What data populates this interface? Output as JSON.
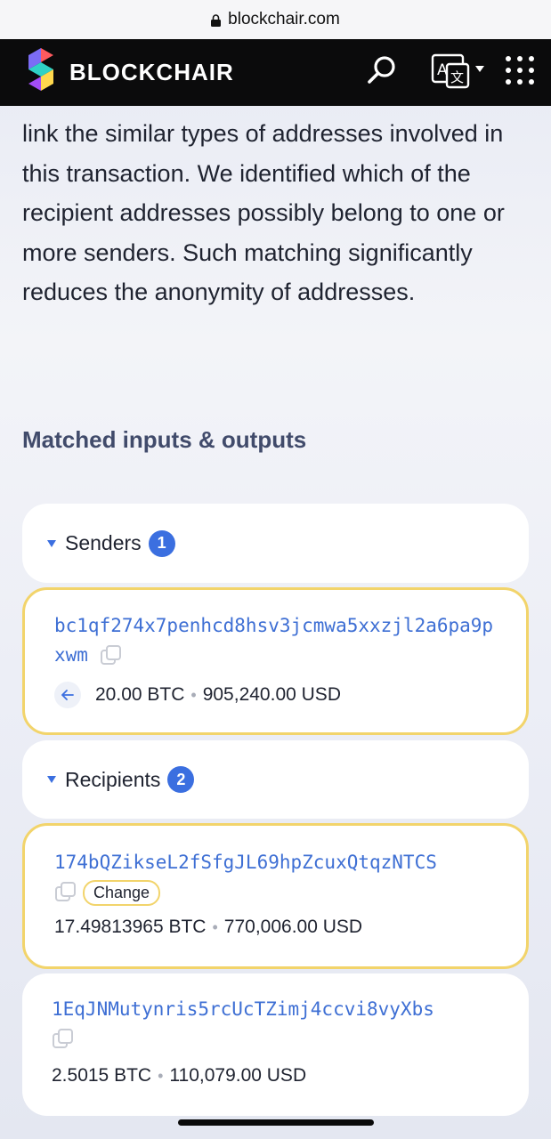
{
  "browser": {
    "url": "blockchair.com"
  },
  "header": {
    "brand": "BLOCKCHAIR"
  },
  "intro": {
    "text": "link the similar types of addresses involved in this transaction. We identified which of the recipient addresses possibly belong to one or more senders. Such matching significantly reduces the anonymity of addresses."
  },
  "section": {
    "title": "Matched inputs & outputs"
  },
  "senders": {
    "label": "Senders",
    "count": "1",
    "items": [
      {
        "address": "bc1qf274x7penhcd8hsv3jcmwa5xxzjl2a6pa9pxwm",
        "btc": "20.00 BTC",
        "usd": "905,240.00 USD"
      }
    ]
  },
  "recipients": {
    "label": "Recipients",
    "count": "2",
    "items": [
      {
        "address": "174bQZikseL2fSfgJL69hpZcuxQtqzNTCS",
        "tag": "Change",
        "btc": "17.49813965 BTC",
        "usd": "770,006.00 USD"
      },
      {
        "address": "1EqJNMutynris5rcUcTZimj4ccvi8vyXbs",
        "btc": "2.5015 BTC",
        "usd": "110,079.00 USD"
      }
    ]
  },
  "separator": "•",
  "colors": {
    "accent": "#3b6fe0",
    "link": "#3e6fd4",
    "highlight_border": "#f2d46b",
    "header_bg": "#0b0b0c"
  }
}
